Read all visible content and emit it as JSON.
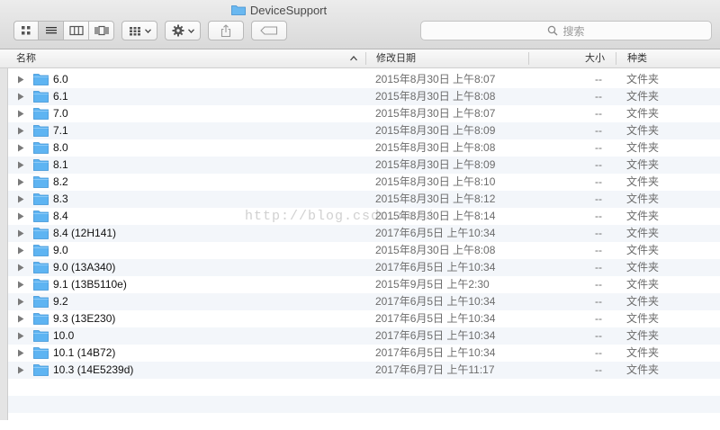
{
  "window": {
    "title": "DeviceSupport"
  },
  "toolbar": {
    "view_buttons": [
      "icon-view-icon",
      "list-view-icon",
      "column-view-icon",
      "coverflow-view-icon"
    ],
    "arrange_icon": "arrange-grid-icon",
    "action_icon": "gear-icon",
    "share_icon": "share-icon",
    "tag_icon": "tag-icon"
  },
  "search": {
    "placeholder": "搜索",
    "icon": "search-icon"
  },
  "columns": {
    "name": "名称",
    "date": "修改日期",
    "size": "大小",
    "kind": "种类"
  },
  "colors": {
    "folder": "#5eb4f2",
    "alt_row": "#f3f6fa",
    "toolbar": "#dedede"
  },
  "rows": [
    {
      "name": "6.0",
      "date": "2015年8月30日 上午8:07",
      "size": "--",
      "kind": "文件夹"
    },
    {
      "name": "6.1",
      "date": "2015年8月30日 上午8:08",
      "size": "--",
      "kind": "文件夹"
    },
    {
      "name": "7.0",
      "date": "2015年8月30日 上午8:07",
      "size": "--",
      "kind": "文件夹"
    },
    {
      "name": "7.1",
      "date": "2015年8月30日 上午8:09",
      "size": "--",
      "kind": "文件夹"
    },
    {
      "name": "8.0",
      "date": "2015年8月30日 上午8:08",
      "size": "--",
      "kind": "文件夹"
    },
    {
      "name": "8.1",
      "date": "2015年8月30日 上午8:09",
      "size": "--",
      "kind": "文件夹"
    },
    {
      "name": "8.2",
      "date": "2015年8月30日 上午8:10",
      "size": "--",
      "kind": "文件夹"
    },
    {
      "name": "8.3",
      "date": "2015年8月30日 上午8:12",
      "size": "--",
      "kind": "文件夹"
    },
    {
      "name": "8.4",
      "date": "2015年8月30日 上午8:14",
      "size": "--",
      "kind": "文件夹"
    },
    {
      "name": "8.4 (12H141)",
      "date": "2017年6月5日 上午10:34",
      "size": "--",
      "kind": "文件夹"
    },
    {
      "name": "9.0",
      "date": "2015年8月30日 上午8:08",
      "size": "--",
      "kind": "文件夹"
    },
    {
      "name": "9.0 (13A340)",
      "date": "2017年6月5日 上午10:34",
      "size": "--",
      "kind": "文件夹"
    },
    {
      "name": "9.1 (13B5110e)",
      "date": "2015年9月5日 上午2:30",
      "size": "--",
      "kind": "文件夹"
    },
    {
      "name": "9.2",
      "date": "2017年6月5日 上午10:34",
      "size": "--",
      "kind": "文件夹"
    },
    {
      "name": "9.3 (13E230)",
      "date": "2017年6月5日 上午10:34",
      "size": "--",
      "kind": "文件夹"
    },
    {
      "name": "10.0",
      "date": "2017年6月5日 上午10:34",
      "size": "--",
      "kind": "文件夹"
    },
    {
      "name": "10.1 (14B72)",
      "date": "2017年6月5日 上午10:34",
      "size": "--",
      "kind": "文件夹"
    },
    {
      "name": "10.3 (14E5239d)",
      "date": "2017年6月7日 上午11:17",
      "size": "--",
      "kind": "文件夹"
    }
  ],
  "watermark": "http://blog.csdn.net/"
}
